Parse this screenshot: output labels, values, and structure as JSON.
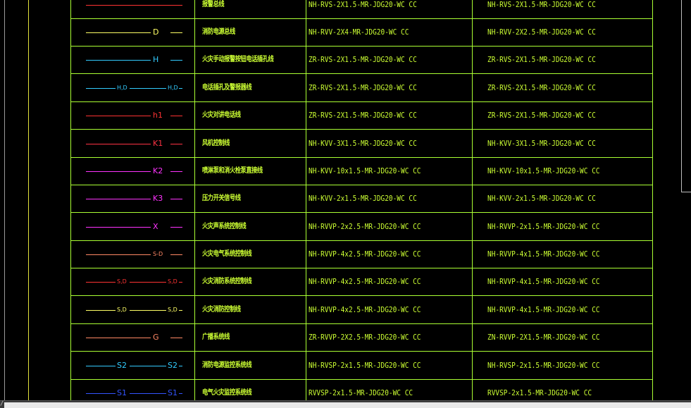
{
  "rows": [
    {
      "symbol": {
        "color": "#ff3333",
        "labels": []
      },
      "name": "报警总线",
      "spec1": "NH-RVS-2X1.5-MR-JDG20-WC CC",
      "spec2": "NH-RVS-2X1.5-MR-JDG20-WC CC"
    },
    {
      "symbol": {
        "color": "#ffff66",
        "labels": [
          "D"
        ]
      },
      "name": "消防电源总线",
      "spec1": "NH-RVV-2X4-MR-JDG20-WC CC",
      "spec2": "NH-RVV-2X2.5-MR-JDG20-WC CC"
    },
    {
      "symbol": {
        "color": "#33ccff",
        "labels": [
          "H"
        ]
      },
      "name": "火灾手动报警按钮电话插孔线",
      "spec1": "ZR-RVS-2X1.5-MR-JDG20-WC CC",
      "spec2": "ZR-RVS-2X1.5-MR-JDG20-WC CC"
    },
    {
      "symbol": {
        "color": "#33ccff",
        "labels": [
          "H,D",
          "H,D"
        ]
      },
      "name": "电话插孔及警报器线",
      "spec1": "ZR-RVS-2X1.5-MR-JDG20-WC CC",
      "spec2": "ZR-RVS-2X1.5-MR-JDG20-WC CC"
    },
    {
      "symbol": {
        "color": "#ff3333",
        "labels": [
          "h1"
        ]
      },
      "name": "火灾对讲电话线",
      "spec1": "ZR-RVS-2X1.5-MR-JDG20-WC CC",
      "spec2": "ZR-RVS-2X1.5-MR-JDG20-WC CC"
    },
    {
      "symbol": {
        "color": "#ff3344",
        "labels": [
          "K1"
        ]
      },
      "name": "风机控制线",
      "spec1": "NH-KVV-3X1.5-MR-JDG20-WC CC",
      "spec2": "NH-KVV-3X1.5-MR-JDG20-WC CC"
    },
    {
      "symbol": {
        "color": "#ff33ff",
        "labels": [
          "K2"
        ]
      },
      "name": "喷淋泵和消火栓泵直接线",
      "spec1": "NH-KVV-10x1.5-MR-JDG20-WC CC",
      "spec2": "NH-KVV-10x1.5-MR-JDG20-WC CC"
    },
    {
      "symbol": {
        "color": "#ff33ff",
        "labels": [
          "K3"
        ]
      },
      "name": "压力开关信号线",
      "spec1": "NH-KVV-2x1.5-MR-JDG20-WC CC",
      "spec2": "NH-KVV-2x1.5-MR-JDG20-WC CC"
    },
    {
      "symbol": {
        "color": "#ff33ff",
        "labels": [
          "X"
        ]
      },
      "name": "火灾声系统控制线",
      "spec1": "NH-RVVP-2x2.5-MR-JDG20-WC CC",
      "spec2": "NH-RVVP-2x1.5-MR-JDG20-WC CC"
    },
    {
      "symbol": {
        "color": "#ff8866",
        "labels": [
          "S-D"
        ]
      },
      "name": "火灾电气系统控制线",
      "spec1": "NH-RVVP-4x2.5-MR-JDG20-WC CC",
      "spec2": "NH-RVVP-4x1.5-MR-JDG20-WC CC"
    },
    {
      "symbol": {
        "color": "#ff3333",
        "labels": [
          "S,D",
          "S,D"
        ]
      },
      "name": "火灾消防系统控制线",
      "spec1": "NH-RVVP-4x2.5-MR-JDG20-WC CC",
      "spec2": "NH-RVVP-4x1.5-MR-JDG20-WC CC"
    },
    {
      "symbol": {
        "color": "#ffff66",
        "labels": [
          "S,D",
          "S,D"
        ]
      },
      "name": "火灾消防控制线",
      "spec1": "NH-RVVP-4x2.5-MR-JDG20-WC CC",
      "spec2": "NH-RVVP-4x1.5-MR-JDG20-WC CC"
    },
    {
      "symbol": {
        "color": "#ff8866",
        "labels": [
          "G"
        ]
      },
      "name": "广播系统线",
      "spec1": "ZR-RVVP-2X2.5-MR-JDG20-WC CC",
      "spec2": "ZN-RVVP-2X1.5-MR-JDG20-WC CC"
    },
    {
      "symbol": {
        "color": "#33ccff",
        "labels": [
          "S2",
          "S2"
        ]
      },
      "name": "消防电源监控系统线",
      "spec1": "NH-RVSP-2x1.5-MR-JDG20-WC CC",
      "spec2": "NH-RVSP-2x1.5-MR-JDG20-WC CC"
    },
    {
      "symbol": {
        "color": "#3355ff",
        "labels": [
          "S1",
          "S1"
        ]
      },
      "name": "电气火灾监控系统线",
      "spec1": "RVVSP-2x1.5-MR-JDG20-WC CC",
      "spec2": "RVVSP-2x1.5-MR-JDG20-WC CC"
    }
  ]
}
